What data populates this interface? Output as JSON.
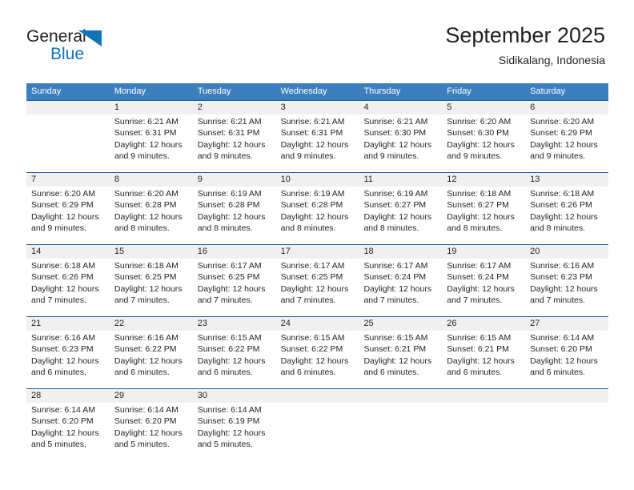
{
  "brand": {
    "name_top": "General",
    "name_bottom": "Blue",
    "triangle_icon": "triangle-icon",
    "colors": {
      "blue": "#1073b9",
      "dark": "#221f1f"
    }
  },
  "header": {
    "title": "September 2025",
    "subtitle": "Sidikalang, Indonesia"
  },
  "theme": {
    "header_bar": "#3c7fbf",
    "week_divider": "#1c5f9e",
    "daynum_band": "#f0f0f0",
    "text": "#231f20"
  },
  "calendar": {
    "weekdays": [
      "Sunday",
      "Monday",
      "Tuesday",
      "Wednesday",
      "Thursday",
      "Friday",
      "Saturday"
    ],
    "labels": {
      "sunrise": "Sunrise:",
      "sunset": "Sunset:",
      "daylight": "Daylight:"
    },
    "weeks": [
      {
        "days": [
          {
            "num": "",
            "l1": "",
            "l2": "",
            "l3": "",
            "l4": ""
          },
          {
            "num": "1",
            "l1": "Sunrise: 6:21 AM",
            "l2": "Sunset: 6:31 PM",
            "l3": "Daylight: 12 hours",
            "l4": "and 9 minutes."
          },
          {
            "num": "2",
            "l1": "Sunrise: 6:21 AM",
            "l2": "Sunset: 6:31 PM",
            "l3": "Daylight: 12 hours",
            "l4": "and 9 minutes."
          },
          {
            "num": "3",
            "l1": "Sunrise: 6:21 AM",
            "l2": "Sunset: 6:31 PM",
            "l3": "Daylight: 12 hours",
            "l4": "and 9 minutes."
          },
          {
            "num": "4",
            "l1": "Sunrise: 6:21 AM",
            "l2": "Sunset: 6:30 PM",
            "l3": "Daylight: 12 hours",
            "l4": "and 9 minutes."
          },
          {
            "num": "5",
            "l1": "Sunrise: 6:20 AM",
            "l2": "Sunset: 6:30 PM",
            "l3": "Daylight: 12 hours",
            "l4": "and 9 minutes."
          },
          {
            "num": "6",
            "l1": "Sunrise: 6:20 AM",
            "l2": "Sunset: 6:29 PM",
            "l3": "Daylight: 12 hours",
            "l4": "and 9 minutes."
          }
        ]
      },
      {
        "days": [
          {
            "num": "7",
            "l1": "Sunrise: 6:20 AM",
            "l2": "Sunset: 6:29 PM",
            "l3": "Daylight: 12 hours",
            "l4": "and 9 minutes."
          },
          {
            "num": "8",
            "l1": "Sunrise: 6:20 AM",
            "l2": "Sunset: 6:28 PM",
            "l3": "Daylight: 12 hours",
            "l4": "and 8 minutes."
          },
          {
            "num": "9",
            "l1": "Sunrise: 6:19 AM",
            "l2": "Sunset: 6:28 PM",
            "l3": "Daylight: 12 hours",
            "l4": "and 8 minutes."
          },
          {
            "num": "10",
            "l1": "Sunrise: 6:19 AM",
            "l2": "Sunset: 6:28 PM",
            "l3": "Daylight: 12 hours",
            "l4": "and 8 minutes."
          },
          {
            "num": "11",
            "l1": "Sunrise: 6:19 AM",
            "l2": "Sunset: 6:27 PM",
            "l3": "Daylight: 12 hours",
            "l4": "and 8 minutes."
          },
          {
            "num": "12",
            "l1": "Sunrise: 6:18 AM",
            "l2": "Sunset: 6:27 PM",
            "l3": "Daylight: 12 hours",
            "l4": "and 8 minutes."
          },
          {
            "num": "13",
            "l1": "Sunrise: 6:18 AM",
            "l2": "Sunset: 6:26 PM",
            "l3": "Daylight: 12 hours",
            "l4": "and 8 minutes."
          }
        ]
      },
      {
        "days": [
          {
            "num": "14",
            "l1": "Sunrise: 6:18 AM",
            "l2": "Sunset: 6:26 PM",
            "l3": "Daylight: 12 hours",
            "l4": "and 7 minutes."
          },
          {
            "num": "15",
            "l1": "Sunrise: 6:18 AM",
            "l2": "Sunset: 6:25 PM",
            "l3": "Daylight: 12 hours",
            "l4": "and 7 minutes."
          },
          {
            "num": "16",
            "l1": "Sunrise: 6:17 AM",
            "l2": "Sunset: 6:25 PM",
            "l3": "Daylight: 12 hours",
            "l4": "and 7 minutes."
          },
          {
            "num": "17",
            "l1": "Sunrise: 6:17 AM",
            "l2": "Sunset: 6:25 PM",
            "l3": "Daylight: 12 hours",
            "l4": "and 7 minutes."
          },
          {
            "num": "18",
            "l1": "Sunrise: 6:17 AM",
            "l2": "Sunset: 6:24 PM",
            "l3": "Daylight: 12 hours",
            "l4": "and 7 minutes."
          },
          {
            "num": "19",
            "l1": "Sunrise: 6:17 AM",
            "l2": "Sunset: 6:24 PM",
            "l3": "Daylight: 12 hours",
            "l4": "and 7 minutes."
          },
          {
            "num": "20",
            "l1": "Sunrise: 6:16 AM",
            "l2": "Sunset: 6:23 PM",
            "l3": "Daylight: 12 hours",
            "l4": "and 7 minutes."
          }
        ]
      },
      {
        "days": [
          {
            "num": "21",
            "l1": "Sunrise: 6:16 AM",
            "l2": "Sunset: 6:23 PM",
            "l3": "Daylight: 12 hours",
            "l4": "and 6 minutes."
          },
          {
            "num": "22",
            "l1": "Sunrise: 6:16 AM",
            "l2": "Sunset: 6:22 PM",
            "l3": "Daylight: 12 hours",
            "l4": "and 6 minutes."
          },
          {
            "num": "23",
            "l1": "Sunrise: 6:15 AM",
            "l2": "Sunset: 6:22 PM",
            "l3": "Daylight: 12 hours",
            "l4": "and 6 minutes."
          },
          {
            "num": "24",
            "l1": "Sunrise: 6:15 AM",
            "l2": "Sunset: 6:22 PM",
            "l3": "Daylight: 12 hours",
            "l4": "and 6 minutes."
          },
          {
            "num": "25",
            "l1": "Sunrise: 6:15 AM",
            "l2": "Sunset: 6:21 PM",
            "l3": "Daylight: 12 hours",
            "l4": "and 6 minutes."
          },
          {
            "num": "26",
            "l1": "Sunrise: 6:15 AM",
            "l2": "Sunset: 6:21 PM",
            "l3": "Daylight: 12 hours",
            "l4": "and 6 minutes."
          },
          {
            "num": "27",
            "l1": "Sunrise: 6:14 AM",
            "l2": "Sunset: 6:20 PM",
            "l3": "Daylight: 12 hours",
            "l4": "and 6 minutes."
          }
        ]
      },
      {
        "days": [
          {
            "num": "28",
            "l1": "Sunrise: 6:14 AM",
            "l2": "Sunset: 6:20 PM",
            "l3": "Daylight: 12 hours",
            "l4": "and 5 minutes."
          },
          {
            "num": "29",
            "l1": "Sunrise: 6:14 AM",
            "l2": "Sunset: 6:20 PM",
            "l3": "Daylight: 12 hours",
            "l4": "and 5 minutes."
          },
          {
            "num": "30",
            "l1": "Sunrise: 6:14 AM",
            "l2": "Sunset: 6:19 PM",
            "l3": "Daylight: 12 hours",
            "l4": "and 5 minutes."
          },
          {
            "num": "",
            "l1": "",
            "l2": "",
            "l3": "",
            "l4": ""
          },
          {
            "num": "",
            "l1": "",
            "l2": "",
            "l3": "",
            "l4": ""
          },
          {
            "num": "",
            "l1": "",
            "l2": "",
            "l3": "",
            "l4": ""
          },
          {
            "num": "",
            "l1": "",
            "l2": "",
            "l3": "",
            "l4": ""
          }
        ]
      }
    ]
  }
}
